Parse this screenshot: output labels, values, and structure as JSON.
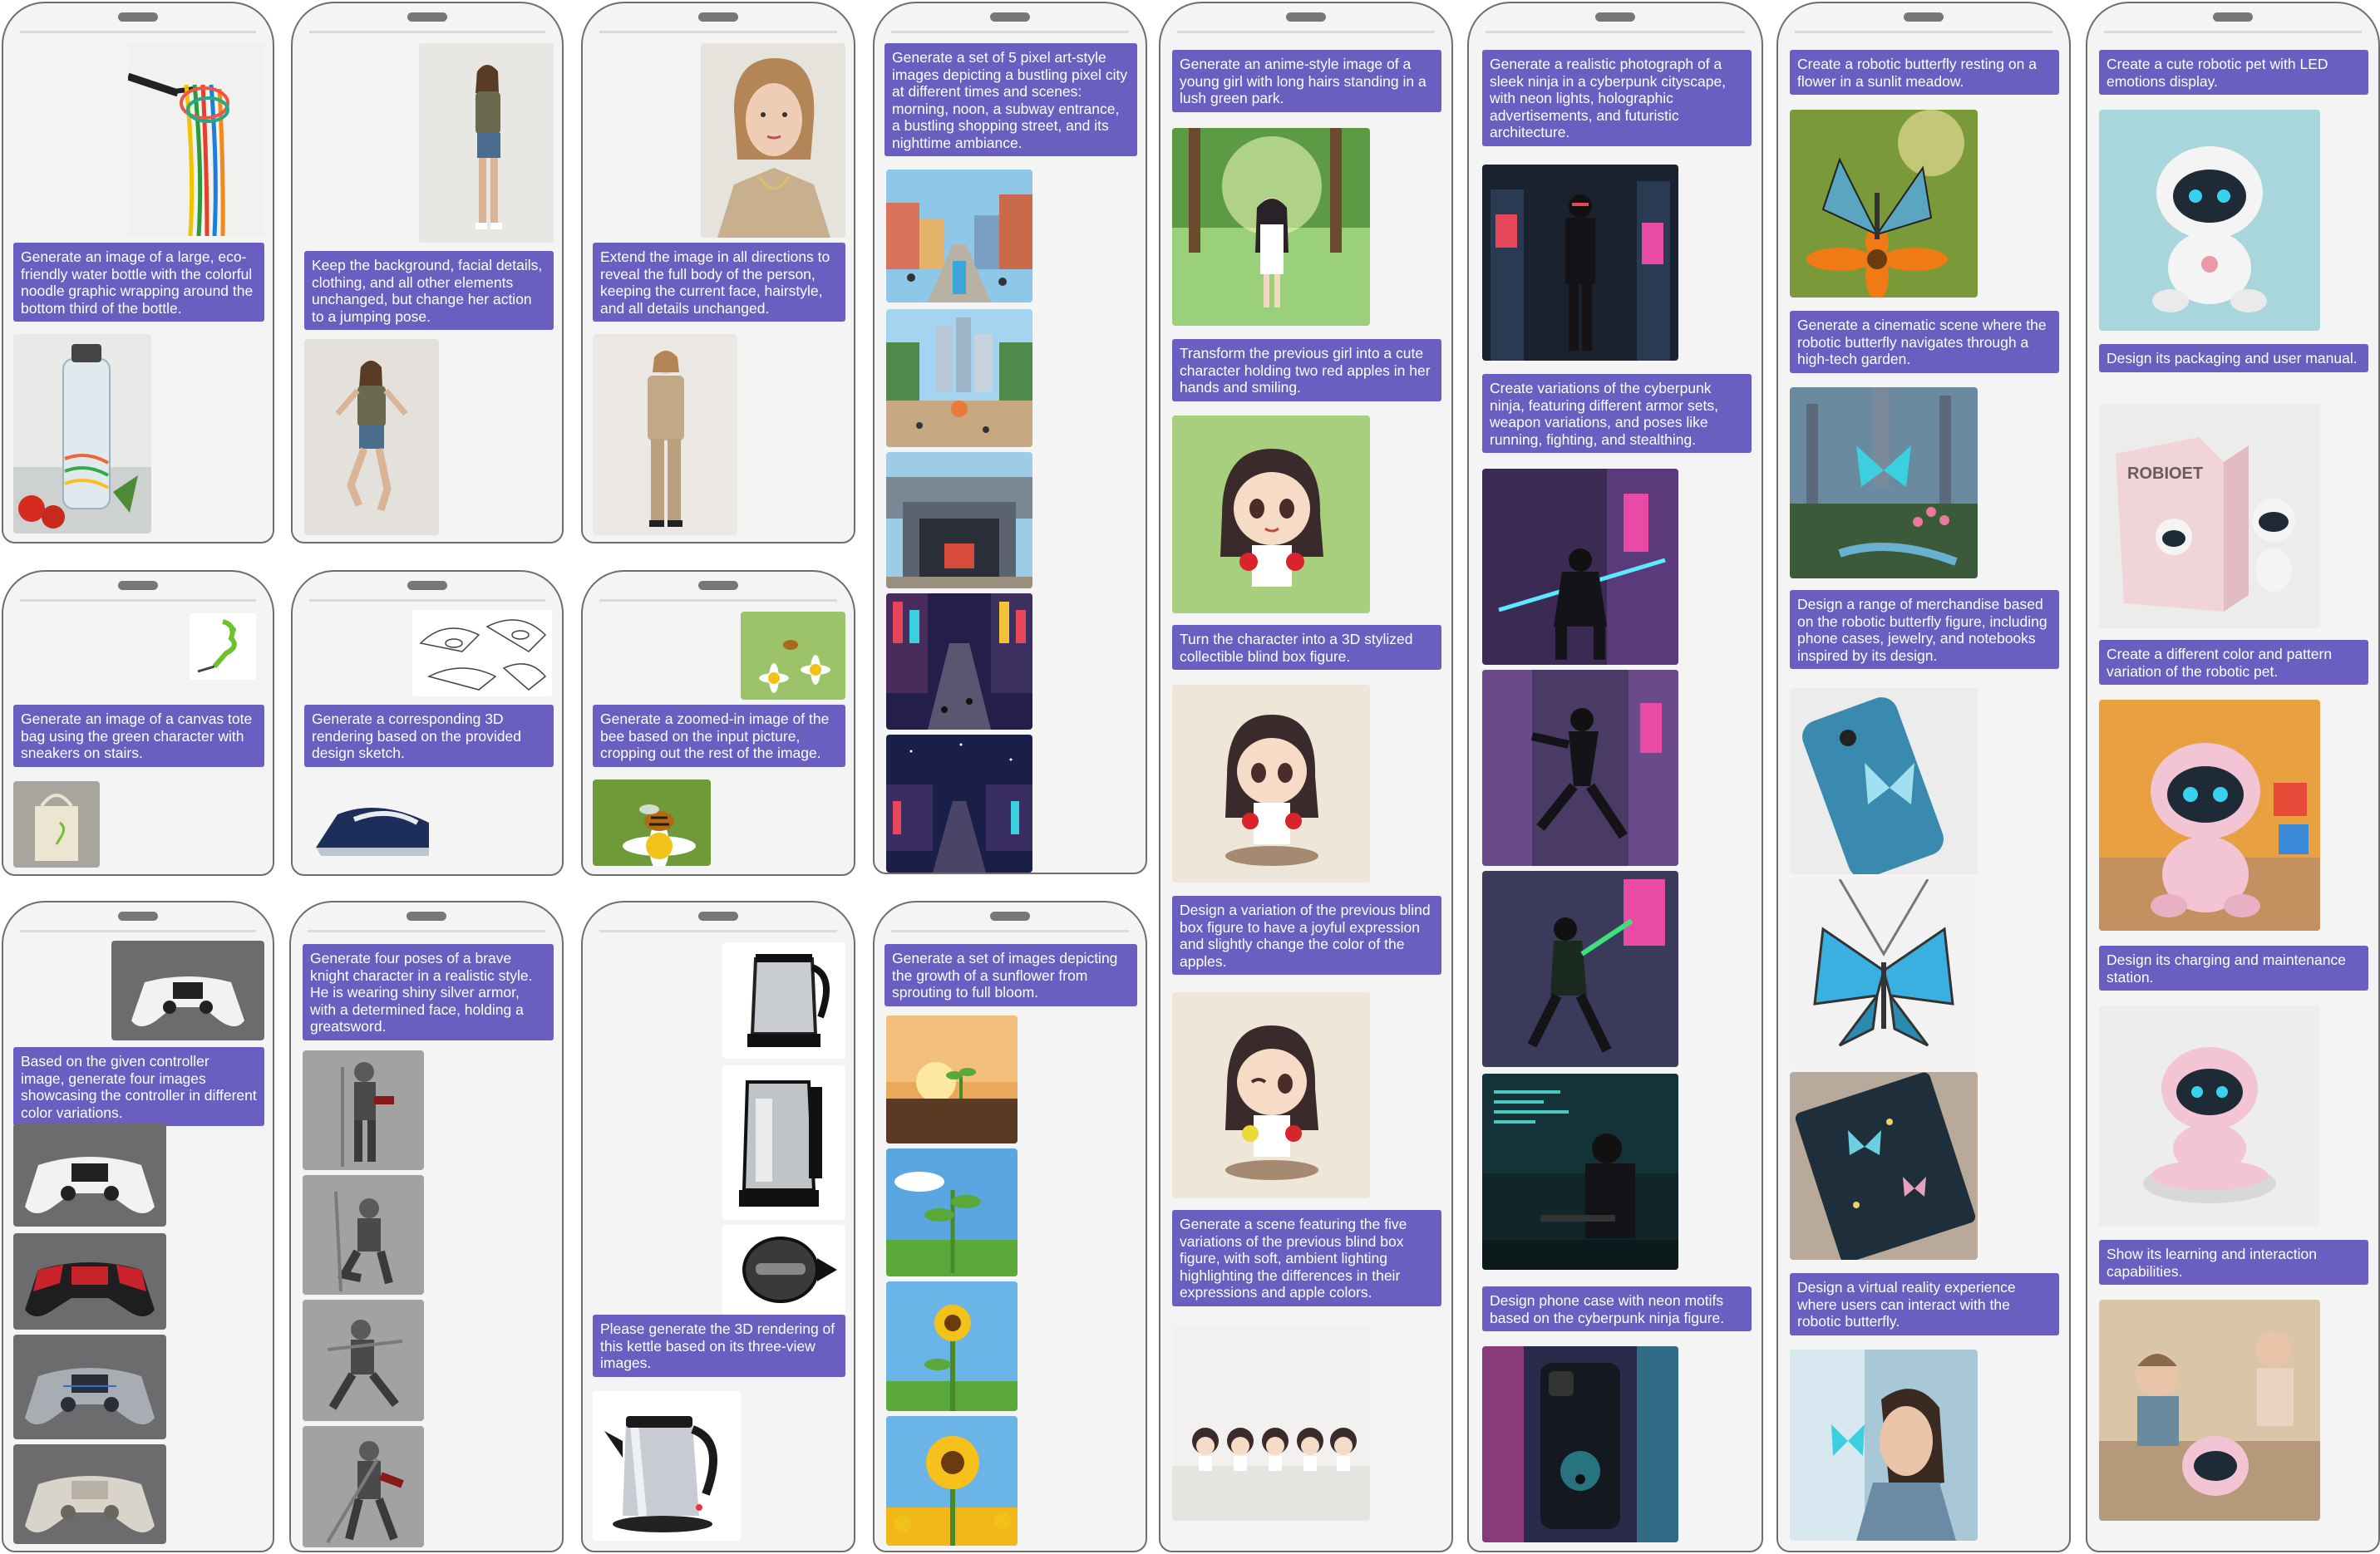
{
  "screenshot_title": "",
  "images": {
    "noodle_fork": "fork-with-colorful-noodles-image",
    "water_bottle": "eco-water-bottle-image",
    "woman_standing": "woman-standing-photo",
    "woman_jumping": "woman-jumping-photo",
    "woman_portrait": "woman-portrait-photo",
    "woman_full_body": "woman-full-body-photo",
    "pixel_city": [
      "pixel-city-morning-image",
      "pixel-city-noon-image",
      "pixel-subway-entrance-image",
      "pixel-shopping-street-image",
      "pixel-nighttime-image"
    ],
    "anime_girl": "anime-girl-park-image",
    "chibi_apples": "chibi-girl-apples-image",
    "blindbox_figure": "blindbox-figure-image",
    "blindbox_wink": "blindbox-figure-wink-image",
    "blindbox_row": "five-figures-row-image",
    "ninja_city": "ninja-cyberpunk-city-image",
    "ninja_variations": [
      "ninja-armor-sword-image",
      "ninja-running-image",
      "ninja-fighting-image",
      "ninja-stealth-hacker-image"
    ],
    "ninja_phone": "ninja-phone-case-image",
    "butterfly_flower": "robotic-butterfly-flower-image",
    "butterfly_garden": "butterfly-garden-image",
    "butterfly_merch": [
      "butterfly-phone-case-image",
      "butterfly-necklace-image",
      "butterfly-notebook-image"
    ],
    "butterfly_vr": "butterfly-vr-woman-image",
    "robot_pet": "robot-pet-image",
    "robot_box": "robot-packaging-image",
    "robot_variant": "robot-color-variant-image",
    "robot_station": "robot-charging-station-image",
    "robot_play": "robot-playing-kid-image",
    "green_character": "green-character-image",
    "tote_bag": "tote-bag-image",
    "iron_sketch": "iron-sketch-image",
    "iron_render": "iron-3d-render-image",
    "bee_flower": "bee-on-flower-image",
    "bee_zoom": "bee-zoomed-image",
    "controller_white": "white-controller-image",
    "controllers": [
      "controller-white-variant-image",
      "controller-red-variant-image",
      "controller-chrome-variant-image",
      "controller-cream-variant-image"
    ],
    "knights": [
      "knight-standing-image",
      "knight-kneeling-image",
      "knight-lunge-image",
      "knight-greatsword-image"
    ],
    "kettle_views": [
      "kettle-front-view-image",
      "kettle-side-view-image",
      "kettle-top-view-image"
    ],
    "kettle_3d": "kettle-3d-render-image",
    "sunflower": [
      "sunflower-sprout-image",
      "sunflower-seedling-image",
      "sunflower-bud-image",
      "sunflower-bloom-image"
    ]
  },
  "messages": {
    "noodle": "Generate an image of a large, eco-friendly water bottle with the colorful noodle graphic wrapping around the bottom third of the bottle.",
    "jump": "Keep the background, facial details, clothing, and all other elements unchanged, but change her action to a jumping pose.",
    "extend": "Extend the image in all directions to reveal the full body of the person, keeping the current face, hairstyle, and all details unchanged.",
    "pixel": "Generate a set of 5 pixel art-style images depicting a bustling pixel city at different times and scenes: morning, noon, a subway entrance, a bustling shopping street, and its nighttime ambiance.",
    "anime1": "Generate an anime-style image of a young girl with long hairs standing in a lush green park.",
    "anime2": "Transform the previous girl into a cute character holding two red apples in her hands and smiling.",
    "anime3": "Turn the character into a 3D stylized collectible blind box figure.",
    "anime4": "Design a variation of the previous blind box figure to have a joyful expression and slightly change the color of the apples.",
    "anime5": "Generate a scene featuring the five variations of the previous blind box figure, with soft, ambient lighting highlighting the differences in their expressions and apple colors.",
    "ninja1": "Generate a realistic photograph of a sleek ninja in a cyberpunk cityscape, with neon lights, holographic advertisements, and futuristic architecture.",
    "ninja2": "Create variations of the cyberpunk ninja, featuring different armor sets, weapon variations, and poses like running, fighting, and stealthing.",
    "ninja3": "Design phone case with neon motifs based on the cyberpunk ninja figure.",
    "bfly1": "Create a robotic butterfly resting on a flower in a sunlit meadow.",
    "bfly2": "Generate a cinematic scene where the robotic butterfly navigates through a high-tech garden.",
    "bfly3": "Design a range of merchandise based on the robotic butterfly figure, including phone cases, jewelry, and notebooks  inspired by its design.",
    "bfly4": "Design a virtual reality experience where users can interact with the robotic butterfly.",
    "robot1": "Create a cute robotic pet with LED emotions display.",
    "robot2": "Design its packaging and user manual.",
    "robot3": "Create a different color and pattern variation of the robotic pet.",
    "robot4": "Design its charging and maintenance station.",
    "robot5": "Show its learning and interaction capabilities.",
    "tote": "Generate an image of a canvas tote bag using the green character with sneakers on stairs.",
    "iron": "Generate a corresponding 3D rendering based on the provided design sketch.",
    "bee": "Generate a zoomed-in image of the bee based on the input picture, cropping out the rest of the image.",
    "controller": "Based on the given controller image, generate four images showcasing the controller in different color variations.",
    "knight": "Generate four poses of a brave knight character in a realistic style. He is wearing shiny silver armor, with a determined face, holding a greatsword.",
    "kettle": "Please generate the 3D rendering of this kettle based on its three-view images.",
    "sunflower": "Generate a set of images depicting the growth of a sunflower from sprouting to full bloom."
  },
  "box_text": {
    "robot_box": "ROBIOET"
  },
  "colors": {
    "bubble": "#6a5ec0",
    "phone_bg": "#f4f4f4",
    "phone_border": "#6e6e6e"
  }
}
